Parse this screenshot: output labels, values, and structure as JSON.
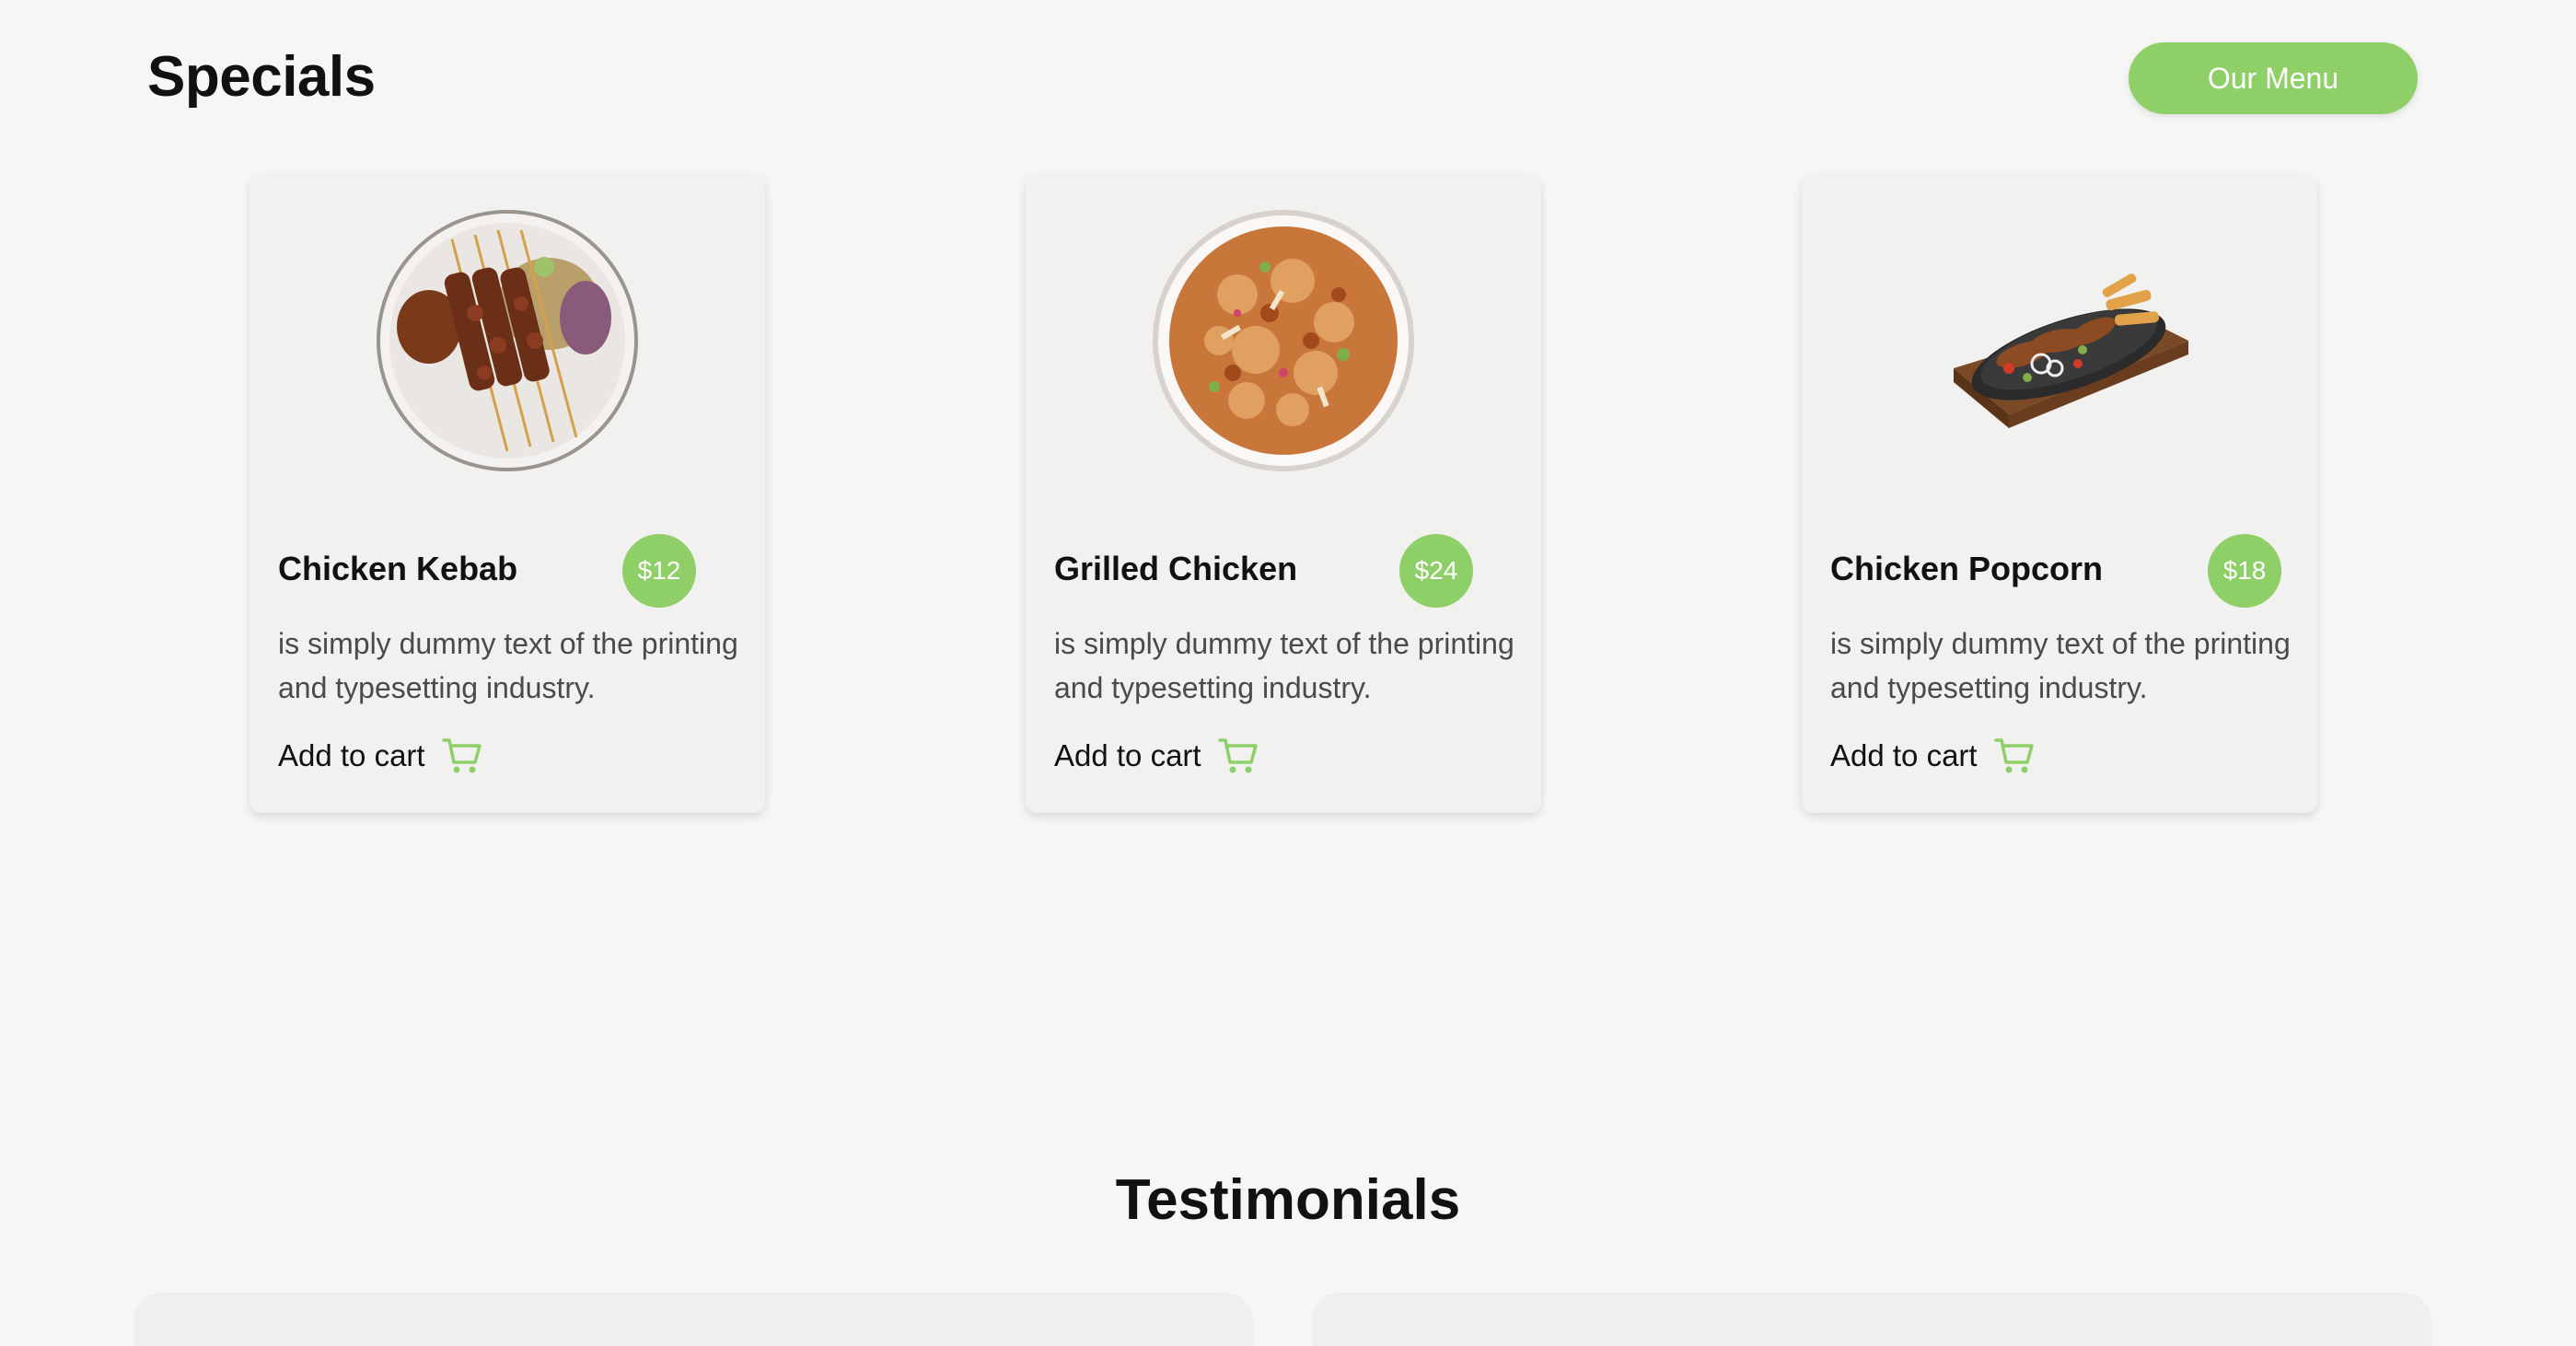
{
  "header": {
    "title": "Specials",
    "menu_button": "Our Menu"
  },
  "specials": [
    {
      "name": "Chicken Kebab",
      "price": "$12",
      "description": "is simply dummy text of the printing and typesetting industry.",
      "cta": "Add to cart"
    },
    {
      "name": "Grilled Chicken",
      "price": "$24",
      "description": "is simply dummy text of the printing and typesetting industry.",
      "cta": "Add to cart"
    },
    {
      "name": "Chicken Popcorn",
      "price": "$18",
      "description": "is simply dummy text of the printing and typesetting industry.",
      "cta": "Add to cart"
    }
  ],
  "testimonials": {
    "title": "Testimonials"
  },
  "icons": {
    "cart": "shopping-cart-icon"
  },
  "colors": {
    "accent": "#8fcf68",
    "background": "#f6f6f4",
    "card": "#f1f1ef"
  }
}
